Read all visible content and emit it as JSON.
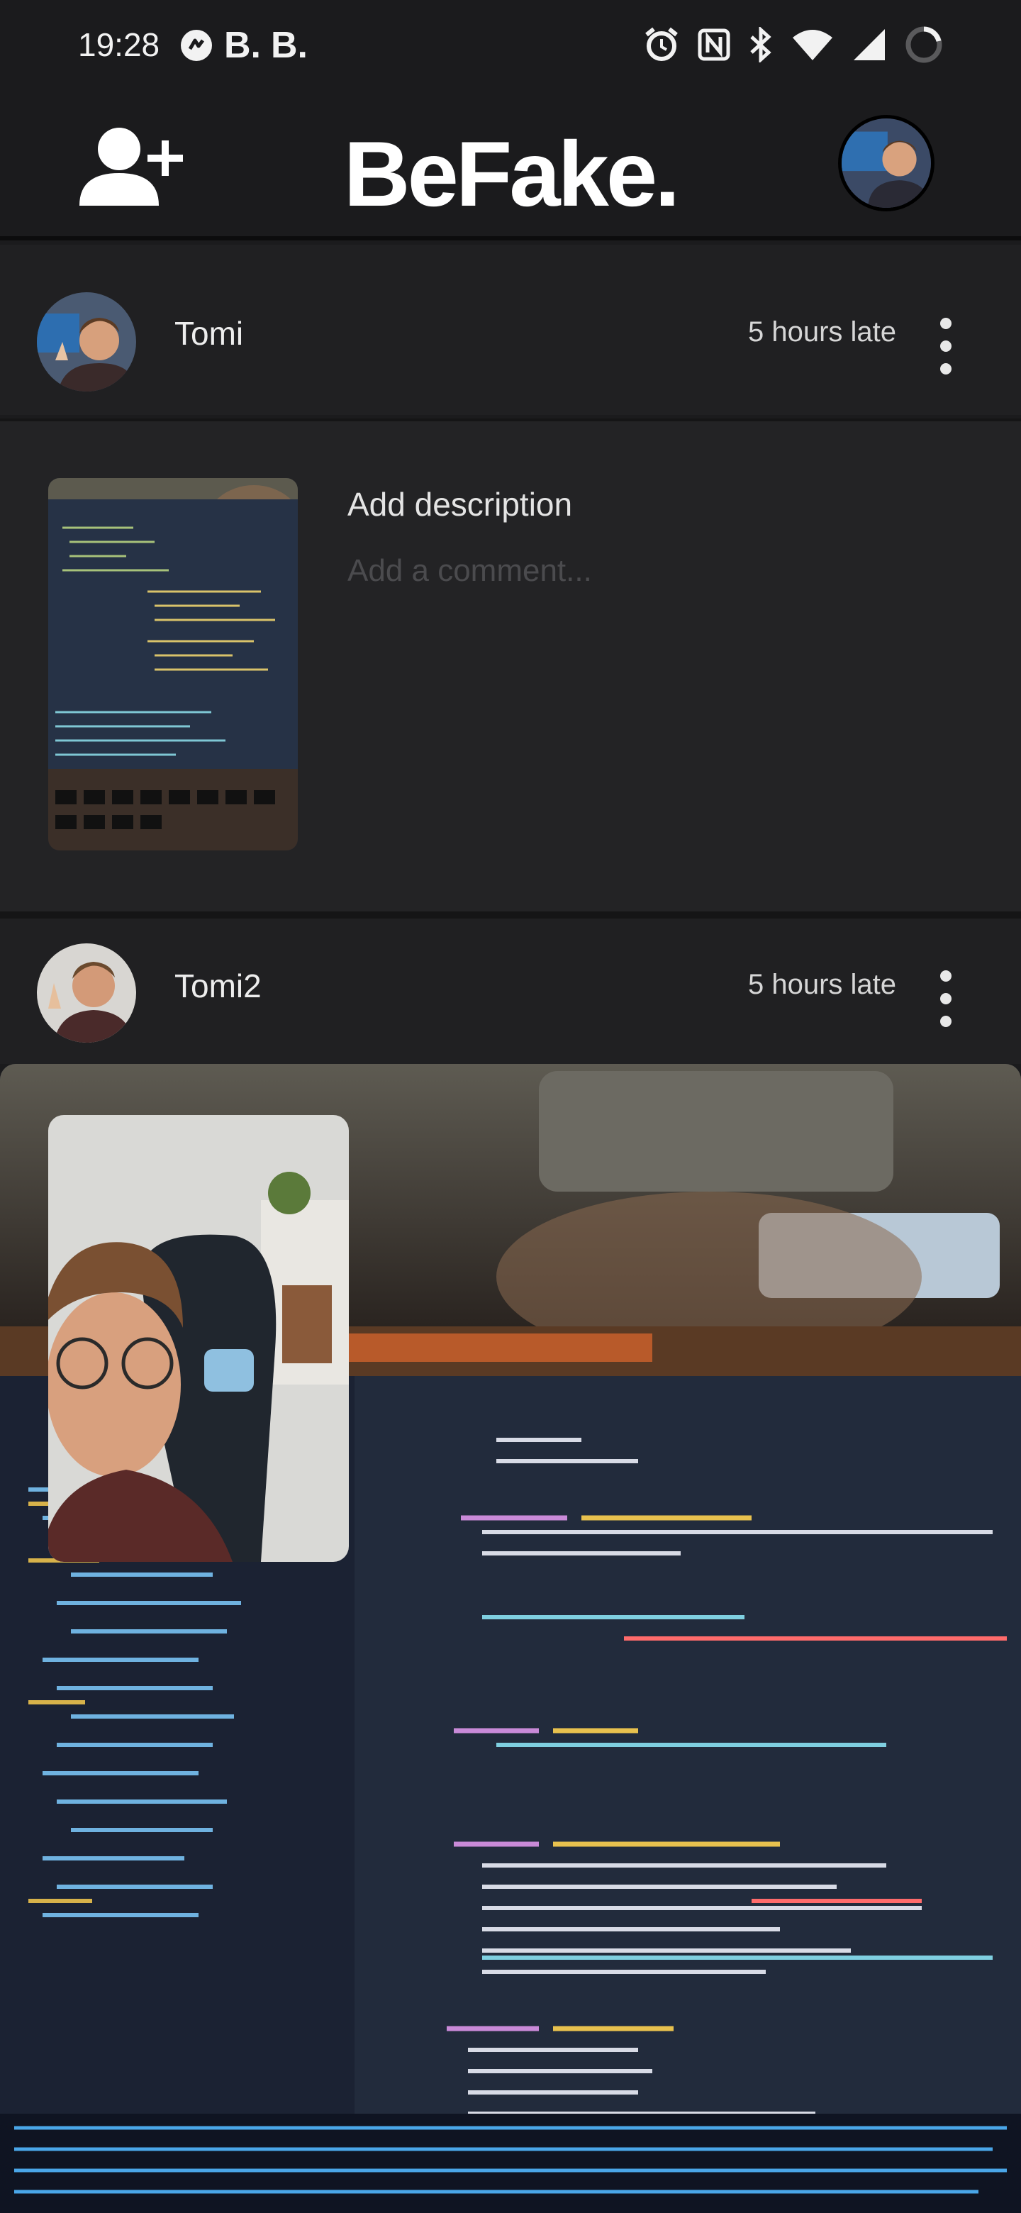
{
  "status_bar": {
    "time": "19:28",
    "left_icons": [
      "messenger-icon",
      "b-icon",
      "b-icon"
    ],
    "left_glyphs": [
      "B.",
      "B."
    ],
    "right_icons": [
      "alarm-icon",
      "nfc-icon",
      "bluetooth-icon",
      "wifi-icon",
      "signal-icon",
      "battery-icon"
    ]
  },
  "app_bar": {
    "title": "BeFake.",
    "add_friend_icon": "add-person-icon",
    "profile_icon": "profile-avatar"
  },
  "feed": {
    "posts": [
      {
        "username": "Tomi",
        "late": "5 hours late",
        "description_prompt": "Add description",
        "comment_placeholder": "Add a comment..."
      },
      {
        "username": "Tomi2",
        "late": "5 hours late"
      }
    ]
  },
  "colors": {
    "background": "#1b1b1d",
    "card": "#202022",
    "text": "#ffffff",
    "muted": "#4b4b4e"
  }
}
